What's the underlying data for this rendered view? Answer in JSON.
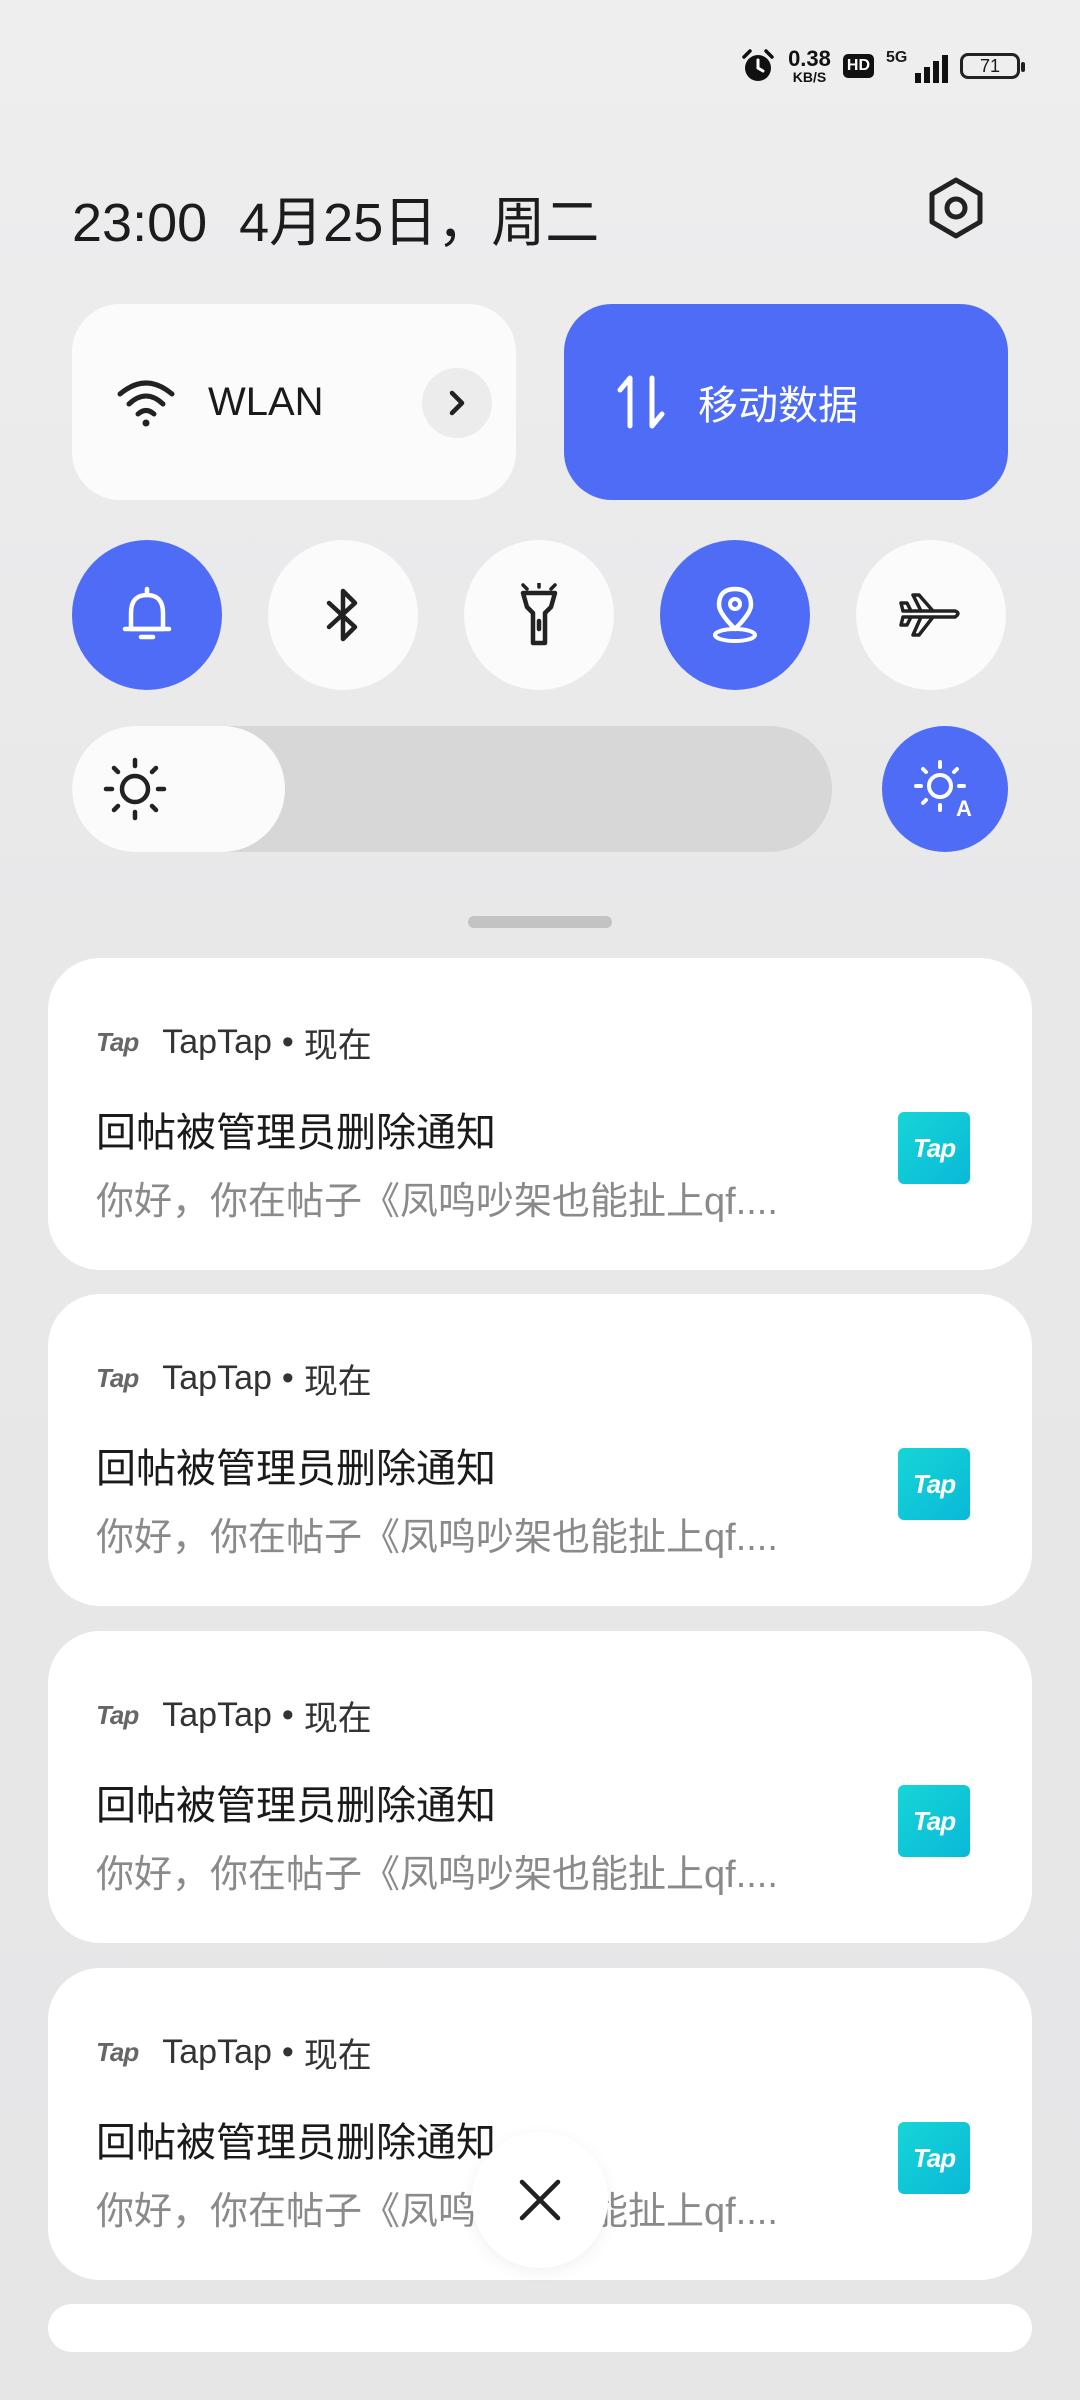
{
  "status": {
    "net_speed_value": "0.38",
    "net_speed_unit": "KB/S",
    "hd_label": "HD",
    "signal_label": "5G",
    "battery": "71"
  },
  "header": {
    "time": "23:00",
    "date": "4月25日，周二"
  },
  "tiles": {
    "wlan_label": "WLAN",
    "data_label": "移动数据"
  },
  "brightness": {
    "level": 0.28
  },
  "notifications": [
    {
      "logo": "Tap",
      "app": "TapTap",
      "separator": "•",
      "time": "现在",
      "title": "回帖被管理员删除通知",
      "body": "你好，你在帖子《凤鸣吵架也能扯上qf....",
      "icon_text": "Tap"
    },
    {
      "logo": "Tap",
      "app": "TapTap",
      "separator": "•",
      "time": "现在",
      "title": "回帖被管理员删除通知",
      "body": "你好，你在帖子《凤鸣吵架也能扯上qf....",
      "icon_text": "Tap"
    },
    {
      "logo": "Tap",
      "app": "TapTap",
      "separator": "•",
      "time": "现在",
      "title": "回帖被管理员删除通知",
      "body": "你好，你在帖子《凤鸣吵架也能扯上qf....",
      "icon_text": "Tap"
    },
    {
      "logo": "Tap",
      "app": "TapTap",
      "separator": "•",
      "time": "现在",
      "title": "回帖被管理员删除通知",
      "body": "你好，你在帖子《凤鸣吵架也能扯上qf....",
      "icon_text": "Tap"
    }
  ],
  "colors": {
    "accent": "#4f6cf7",
    "tap_teal": "#15d6d6"
  }
}
